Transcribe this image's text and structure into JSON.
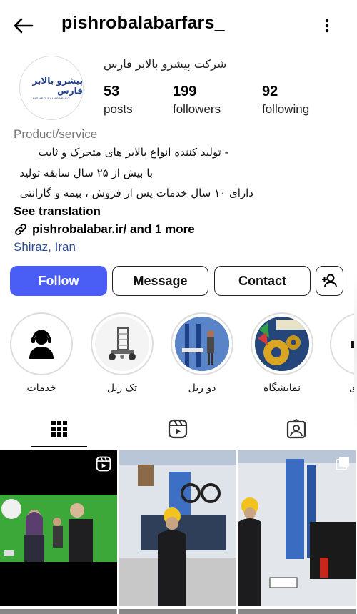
{
  "header": {
    "username": "pishrobalabarfars_",
    "back_icon": "arrow-left-icon",
    "more_icon": "vertical-dots-icon"
  },
  "profile": {
    "avatar_logo_text": "پیشرو بالابر فارس",
    "avatar_logo_sub": "PISHRO BALABAR CO",
    "full_name": "شرکت پیشرو بالابر فارس",
    "stats": [
      {
        "value": "53",
        "label": "posts"
      },
      {
        "value": "199",
        "label": "followers"
      },
      {
        "value": "92",
        "label": "following"
      }
    ],
    "category": "Product/service",
    "bio": [
      "- تولید کننده انواع بالابر های متحرک و ثابت",
      "با بیش از ۲۵ سال سابقه تولید",
      "دارای ۱۰ سال خدمات پس از فروش ، بیمه و گارانتی"
    ],
    "see_translation": "See translation",
    "link_text": "pishrobalabar.ir/ and 1 more",
    "location": "Shiraz, Iran"
  },
  "actions": {
    "follow": "Follow",
    "message": "Message",
    "contact": "Contact"
  },
  "highlights": [
    {
      "label": "خدمات"
    },
    {
      "label": "تک ریل"
    },
    {
      "label": "دو ریل"
    },
    {
      "label": "نمایشگاه"
    },
    {
      "label": "ی"
    }
  ],
  "tabs": [
    "grid-icon",
    "reels-icon",
    "tagged-icon"
  ],
  "colors": {
    "follow_button": "#4a5df5",
    "location_link": "#2b4a9c",
    "category_text": "#777777"
  }
}
